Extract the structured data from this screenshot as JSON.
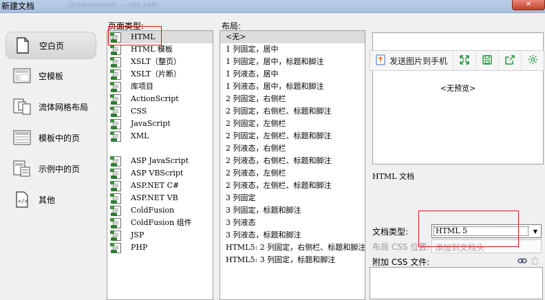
{
  "window": {
    "title": "新建文档",
    "background_path": "Dreamweaver — site path"
  },
  "categories": [
    {
      "label": "空白页",
      "icon": "blank-page-icon",
      "selected": true
    },
    {
      "label": "空模板",
      "icon": "blank-template-icon",
      "selected": false
    },
    {
      "label": "流体网格布局",
      "icon": "fluid-grid-icon",
      "selected": false
    },
    {
      "label": "模板中的页",
      "icon": "template-page-icon",
      "selected": false
    },
    {
      "label": "示例中的页",
      "icon": "sample-page-icon",
      "selected": false
    },
    {
      "label": "其他",
      "icon": "other-code-icon",
      "selected": false
    }
  ],
  "page_type": {
    "label": "页面类型:",
    "items": [
      "HTML",
      "HTML 模板",
      "XSLT（整页）",
      "XSLT（片断）",
      "库项目",
      "ActionScript",
      "CSS",
      "JavaScript",
      "XML",
      "",
      "ASP JavaScript",
      "ASP VBScript",
      "ASP.NET C#",
      "ASP.NET VB",
      "ColdFusion",
      "ColdFusion 组件",
      "JSP",
      "PHP"
    ],
    "selected": "HTML"
  },
  "layout": {
    "label": "布局:",
    "items": [
      "<无>",
      "1 列固定，居中",
      "1 列固定，居中，标题和脚注",
      "1 列液态，居中",
      "1 列液态，居中，标题和脚注",
      "2 列固定，右侧栏",
      "2 列固定，右侧栏、标题和脚注",
      "2 列固定，左侧栏",
      "2 列固定，左侧栏、标题和脚注",
      "2 列液态，右侧栏",
      "2 列液态，右侧栏、标题和脚注",
      "2 列液态，左侧栏",
      "2 列液态，左侧栏、标题和脚注",
      "3 列固定",
      "3 列固定，标题和脚注",
      "3 列液态",
      "3 列液态，标题和脚注",
      "HTML5: 2 列固定，右侧栏、标题和脚注",
      "HTML5: 3 列固定，标题和脚注"
    ],
    "selected": "<无>"
  },
  "preview": {
    "text": "<无预览>"
  },
  "phone_toolbar": {
    "send_label": "发送图片到手机",
    "buttons": [
      "expand-icon",
      "save-icon",
      "share-icon",
      "settings-icon"
    ]
  },
  "description": "HTML 文档",
  "doctype": {
    "label": "文档类型:",
    "value": "HTML 5"
  },
  "layout_css": {
    "label": "布局 CSS 位置:",
    "value": "添加到文档头"
  },
  "attach_css": {
    "label": "附加 CSS 文件:"
  },
  "colors": {
    "highlight": "#dcdcdc",
    "annotation": "#dd1111",
    "accent_green": "#1a9a3a"
  }
}
